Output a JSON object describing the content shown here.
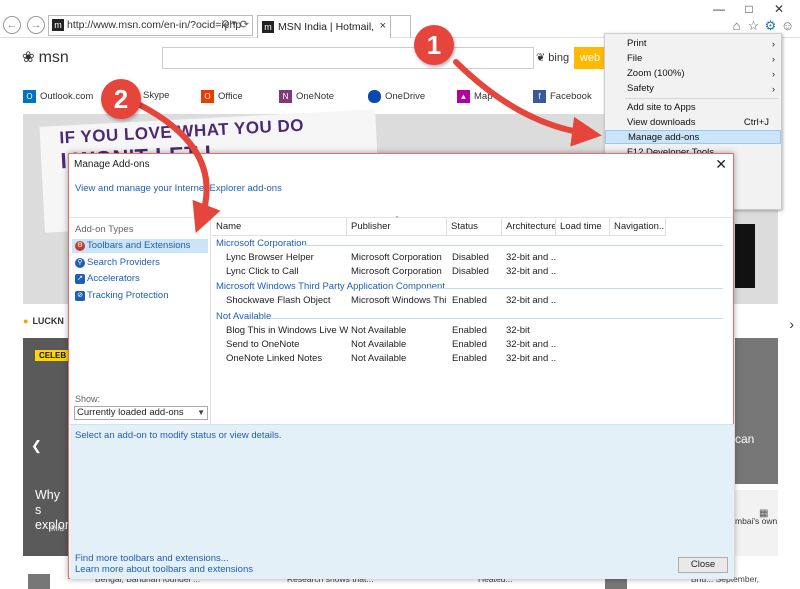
{
  "browser": {
    "url": "http://www.msn.com/en-in/?ocid=iehp",
    "tab_title": "MSN India | Hotmail, Outlo...",
    "colors": {
      "accent": "#1e73be"
    }
  },
  "msn": {
    "logo_text": "msn",
    "search_engine": "bing",
    "search_button": "web",
    "apps": [
      {
        "label": "Outlook.com",
        "icon": "outlook-icon",
        "color": "#0072c6"
      },
      {
        "label": "Skype",
        "icon": "skype-icon",
        "color": "#00aff0"
      },
      {
        "label": "Office",
        "icon": "office-icon",
        "color": "#eb3c00"
      },
      {
        "label": "OneNote",
        "icon": "onenote-icon",
        "color": "#80397b"
      },
      {
        "label": "OneDrive",
        "icon": "onedrive-icon",
        "color": "#094ab2"
      },
      {
        "label": "Map",
        "icon": "maps-icon",
        "color": "#b4009e"
      },
      {
        "label": "Facebook",
        "icon": "facebook-icon",
        "color": "#3b5998"
      }
    ],
    "banner_line1": "IF YOU LOVE WHAT YOU DO",
    "banner_line2": "I WON'T LET I",
    "weather_label": "LUCKN",
    "story_badge": "CELEB",
    "story_headline_1": "Why s",
    "story_headline_2": "explor",
    "story_source": "Mid-",
    "story_right_text": "can",
    "story_right2_line1": "mbai's own",
    "bottom_left_text": "Bengal, Bandhan founder'...",
    "bottom_mid_text1": "Research shows that...",
    "bottom_mid_text2": "Heated...",
    "bottom_right_text": "Bhu... September,"
  },
  "tools_menu": {
    "items": [
      {
        "label": "Print",
        "submenu": true
      },
      {
        "label": "File",
        "submenu": true
      },
      {
        "label": "Zoom (100%)",
        "submenu": true
      },
      {
        "label": "Safety",
        "submenu": true
      },
      {
        "label": "Add site to Apps"
      },
      {
        "label": "View downloads",
        "shortcut": "Ctrl+J"
      },
      {
        "label": "Manage add-ons",
        "highlighted": true
      },
      {
        "label": "F12 Developer Tools"
      }
    ]
  },
  "dialog": {
    "title": "Manage Add-ons",
    "close_glyph": "✕",
    "header_link": "View and manage your Internet Explorer add-ons",
    "addon_types_header": "Add-on Types",
    "addon_types": [
      {
        "label": "Toolbars and Extensions",
        "selected": true,
        "icon": "gear-icon",
        "color": "#c0392b"
      },
      {
        "label": "Search Providers",
        "icon": "search-icon",
        "color": "#1f5fb3"
      },
      {
        "label": "Accelerators",
        "icon": "accelerator-icon",
        "color": "#1f5fb3"
      },
      {
        "label": "Tracking Protection",
        "icon": "block-icon",
        "color": "#1f5fb3"
      }
    ],
    "show_label": "Show:",
    "show_value": "Currently loaded add-ons",
    "columns": [
      "Name",
      "Publisher",
      "Status",
      "Architecture",
      "Load time",
      "Navigation..."
    ],
    "groups": [
      {
        "name": "Microsoft Corporation",
        "rows": [
          [
            "Lync Browser Helper",
            "Microsoft Corporation",
            "Disabled",
            "32-bit and ..."
          ],
          [
            "Lync Click to Call",
            "Microsoft Corporation",
            "Disabled",
            "32-bit and ..."
          ]
        ]
      },
      {
        "name": "Microsoft Windows Third Party Application Component",
        "rows": [
          [
            "Shockwave Flash Object",
            "Microsoft Windows Thir...",
            "Enabled",
            "32-bit and ..."
          ]
        ]
      },
      {
        "name": "Not Available",
        "rows": [
          [
            "Blog This in Windows Live Writer",
            "Not Available",
            "Enabled",
            "32-bit"
          ],
          [
            "Send to OneNote",
            "Not Available",
            "Enabled",
            "32-bit and ..."
          ],
          [
            "OneNote Linked Notes",
            "Not Available",
            "Enabled",
            "32-bit and ..."
          ]
        ]
      }
    ],
    "detail_message": "Select an add-on to modify status or view details.",
    "find_more": "Find more toolbars and extensions...",
    "learn_more": "Learn more about toolbars and extensions",
    "close_button": "Close"
  },
  "annotations": {
    "step1": "1",
    "step2": "2",
    "color": "#e5453a"
  }
}
